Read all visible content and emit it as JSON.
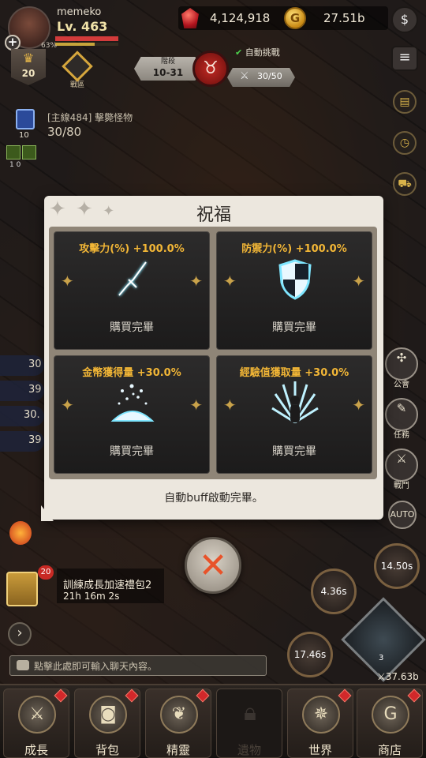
{
  "hud": {
    "player_name": "memeko",
    "level": "Lv. 463",
    "exp_percent": "63%",
    "rank_number": "20",
    "emblem_label": "戰區",
    "gems": "4,124,918",
    "coin_symbol": "G",
    "gold": "27.51b",
    "stage_label": "階段",
    "stage_value": "10-31",
    "auto_challenge": "自動挑戰",
    "wave": "30/50",
    "quest_title": "[主線484] 擊斃怪物",
    "quest_progress": "30/80",
    "quest_count": "10",
    "mini_vals": "1    0"
  },
  "modal": {
    "title": "祝福",
    "cards": [
      {
        "head": "攻擊力(%) +100.0%",
        "status": "購買完畢",
        "icon": "dagger-icon"
      },
      {
        "head": "防禦力(%) +100.0%",
        "status": "購買完畢",
        "icon": "shield-icon"
      },
      {
        "head": "金幣獲得量 +30.0%",
        "status": "購買完畢",
        "icon": "gold-pile-icon"
      },
      {
        "head": "經驗值獲取量 +30.0%",
        "status": "購買完畢",
        "icon": "exp-burst-icon"
      }
    ],
    "footer": "自動buff啟動完畢。",
    "close_icon": "close-icon"
  },
  "left": {
    "bars": [
      "30",
      "39",
      "30.",
      "39"
    ],
    "pack_badge": "20",
    "pack_title": "訓練成長加速禮包2",
    "pack_time": "21h 16m 2s",
    "arrow": "›",
    "chat_placeholder": "點擊此處即可輸入聊天內容。"
  },
  "right": {
    "side": [
      {
        "label": "公會",
        "icon": "guild-icon"
      },
      {
        "label": "任務",
        "icon": "quest-icon"
      },
      {
        "label": "戰鬥",
        "icon": "battle-icon"
      },
      {
        "label": "AUTO",
        "icon": "auto-icon"
      }
    ],
    "skill_timers": [
      "14.50s",
      "4.36s",
      "17.46s"
    ],
    "hero_level": "3",
    "power": "37.63b"
  },
  "nav": {
    "items": [
      {
        "label": "成長",
        "locked": false,
        "dot": true
      },
      {
        "label": "背包",
        "locked": false,
        "dot": true
      },
      {
        "label": "精靈",
        "locked": false,
        "dot": true
      },
      {
        "label": "遺物",
        "locked": true,
        "dot": false
      },
      {
        "label": "世界",
        "locked": false,
        "dot": true
      },
      {
        "label": "商店",
        "locked": false,
        "dot": true
      }
    ]
  },
  "colors": {
    "card_head": "#f2b636",
    "modal_bg": "#ece7de",
    "close_x": "#e8532a",
    "badge_red": "#d2282a",
    "hp_red": "#d23b3b"
  }
}
